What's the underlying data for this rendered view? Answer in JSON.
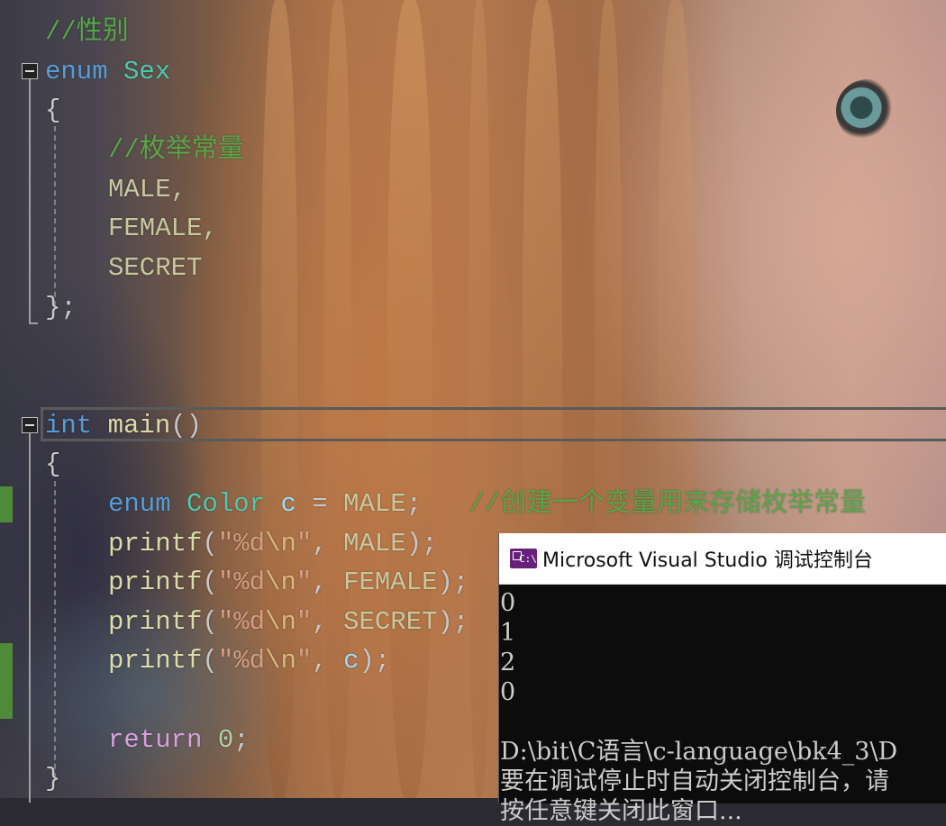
{
  "editor": {
    "lines": {
      "comment_sex": "//性别",
      "enum_kw": "enum",
      "enum_name": "Sex",
      "open_brace_1": "{",
      "comment_enum": "//枚举常量",
      "member_1": "MALE,",
      "member_2": "FEMALE,",
      "member_3": "SECRET",
      "close_brace_1": "};",
      "int_kw": "int",
      "main_name": "main",
      "main_parens": "()",
      "open_brace_2": "{",
      "decl_enum": "enum",
      "decl_type": "Color",
      "decl_var": "c",
      "decl_eq": " = ",
      "decl_val": "MALE",
      "decl_semi": ";",
      "decl_comment": "//创建一个变量用来存储枚举常量",
      "printf": "printf",
      "paren_open": "(",
      "quote_open": "\"",
      "fmt": "%d",
      "esc": "\\n",
      "quote_close": "\"",
      "comma": ", ",
      "arg_1": "MALE",
      "arg_2": "FEMALE",
      "arg_3": "SECRET",
      "arg_4": "c",
      "paren_close": ");",
      "return_kw": "return",
      "return_val": "0",
      "semi": ";",
      "close_brace_2": "}"
    }
  },
  "console": {
    "title": "Microsoft Visual Studio 调试控制台",
    "icon": "vs-console-icon",
    "icon_text": "C:\\",
    "output": [
      "0",
      "1",
      "2",
      "0",
      "",
      "D:\\bit\\C语言\\c-language\\bk4_3\\D",
      "要在调试停止时自动关闭控制台，请",
      "按任意键关闭此窗口..."
    ]
  },
  "colors": {
    "keyword": "#569cd6",
    "type": "#4ec9b0",
    "comment": "#57a64a",
    "function": "#dcdcaa",
    "string": "#d69d85",
    "console_bg": "#0c0c0c",
    "change_bar": "#4f8a3a"
  }
}
